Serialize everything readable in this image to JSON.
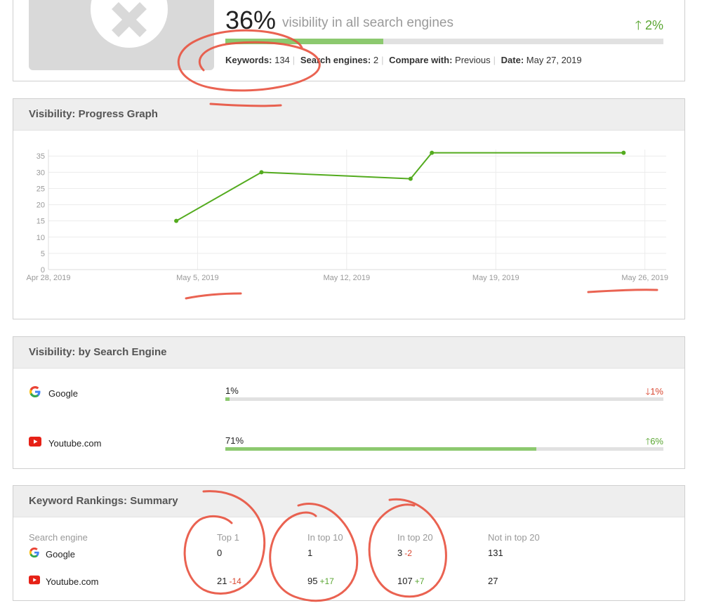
{
  "summary": {
    "visibility_pct": "36%",
    "visibility_label": "visibility in all search engines",
    "delta": "2%",
    "bar_fill_fraction": 0.36,
    "keywords_label": "Keywords:",
    "keywords_value": "134",
    "engines_label": "Search engines:",
    "engines_value": "2",
    "compare_label": "Compare with:",
    "compare_value": "Previous",
    "date_label": "Date:",
    "date_value": "May 27, 2019"
  },
  "progress_graph": {
    "title": "Visibility: Progress Graph"
  },
  "chart_data": {
    "type": "line",
    "series": [
      {
        "x": [
          "2019-05-04",
          "2019-05-08",
          "2019-05-15",
          "2019-05-16",
          "2019-05-25"
        ],
        "y": [
          15,
          30,
          28,
          36,
          36
        ]
      }
    ],
    "x_tick_labels": [
      "Apr 28, 2019",
      "May 5, 2019",
      "May 12, 2019",
      "May 19, 2019",
      "May 26, 2019"
    ],
    "x_tick_dates": [
      "2019-04-28",
      "2019-05-05",
      "2019-05-12",
      "2019-05-19",
      "2019-05-26"
    ],
    "xlim": [
      "2019-04-28",
      "2019-05-27"
    ],
    "y_ticks": [
      0,
      5,
      10,
      15,
      20,
      25,
      30,
      35
    ],
    "ylim": [
      0,
      37
    ],
    "grid": true,
    "color": "#53ab1e"
  },
  "engines": {
    "title": "Visibility: by Search Engine",
    "rows": [
      {
        "name": "Google",
        "pct": "1%",
        "fill": 0.01,
        "delta": "1%",
        "direction": "down",
        "icon": "google-icon"
      },
      {
        "name": "Youtube.com",
        "pct": "71%",
        "fill": 0.71,
        "delta": "6%",
        "direction": "up",
        "icon": "youtube-icon"
      }
    ]
  },
  "rankings": {
    "title": "Keyword Rankings: Summary",
    "headers": [
      "Search engine",
      "Top 1",
      "In top 10",
      "In top 20",
      "Not in top 20"
    ],
    "rows": [
      {
        "name": "Google",
        "icon": "google-icon",
        "top1": "0",
        "top1_chg": "",
        "top10": "1",
        "top10_chg": "",
        "top20": "3",
        "top20_chg": "-2",
        "not20": "131"
      },
      {
        "name": "Youtube.com",
        "icon": "youtube-icon",
        "top1": "21",
        "top1_chg": "-14",
        "top10": "95",
        "top10_chg": "+17",
        "top20": "107",
        "top20_chg": "+7",
        "not20": "27"
      }
    ]
  },
  "colors": {
    "accent_green": "#5aa632",
    "bar_green": "#8cc96f",
    "down_red": "#d9462f",
    "annotation_red": "#e8523f"
  }
}
